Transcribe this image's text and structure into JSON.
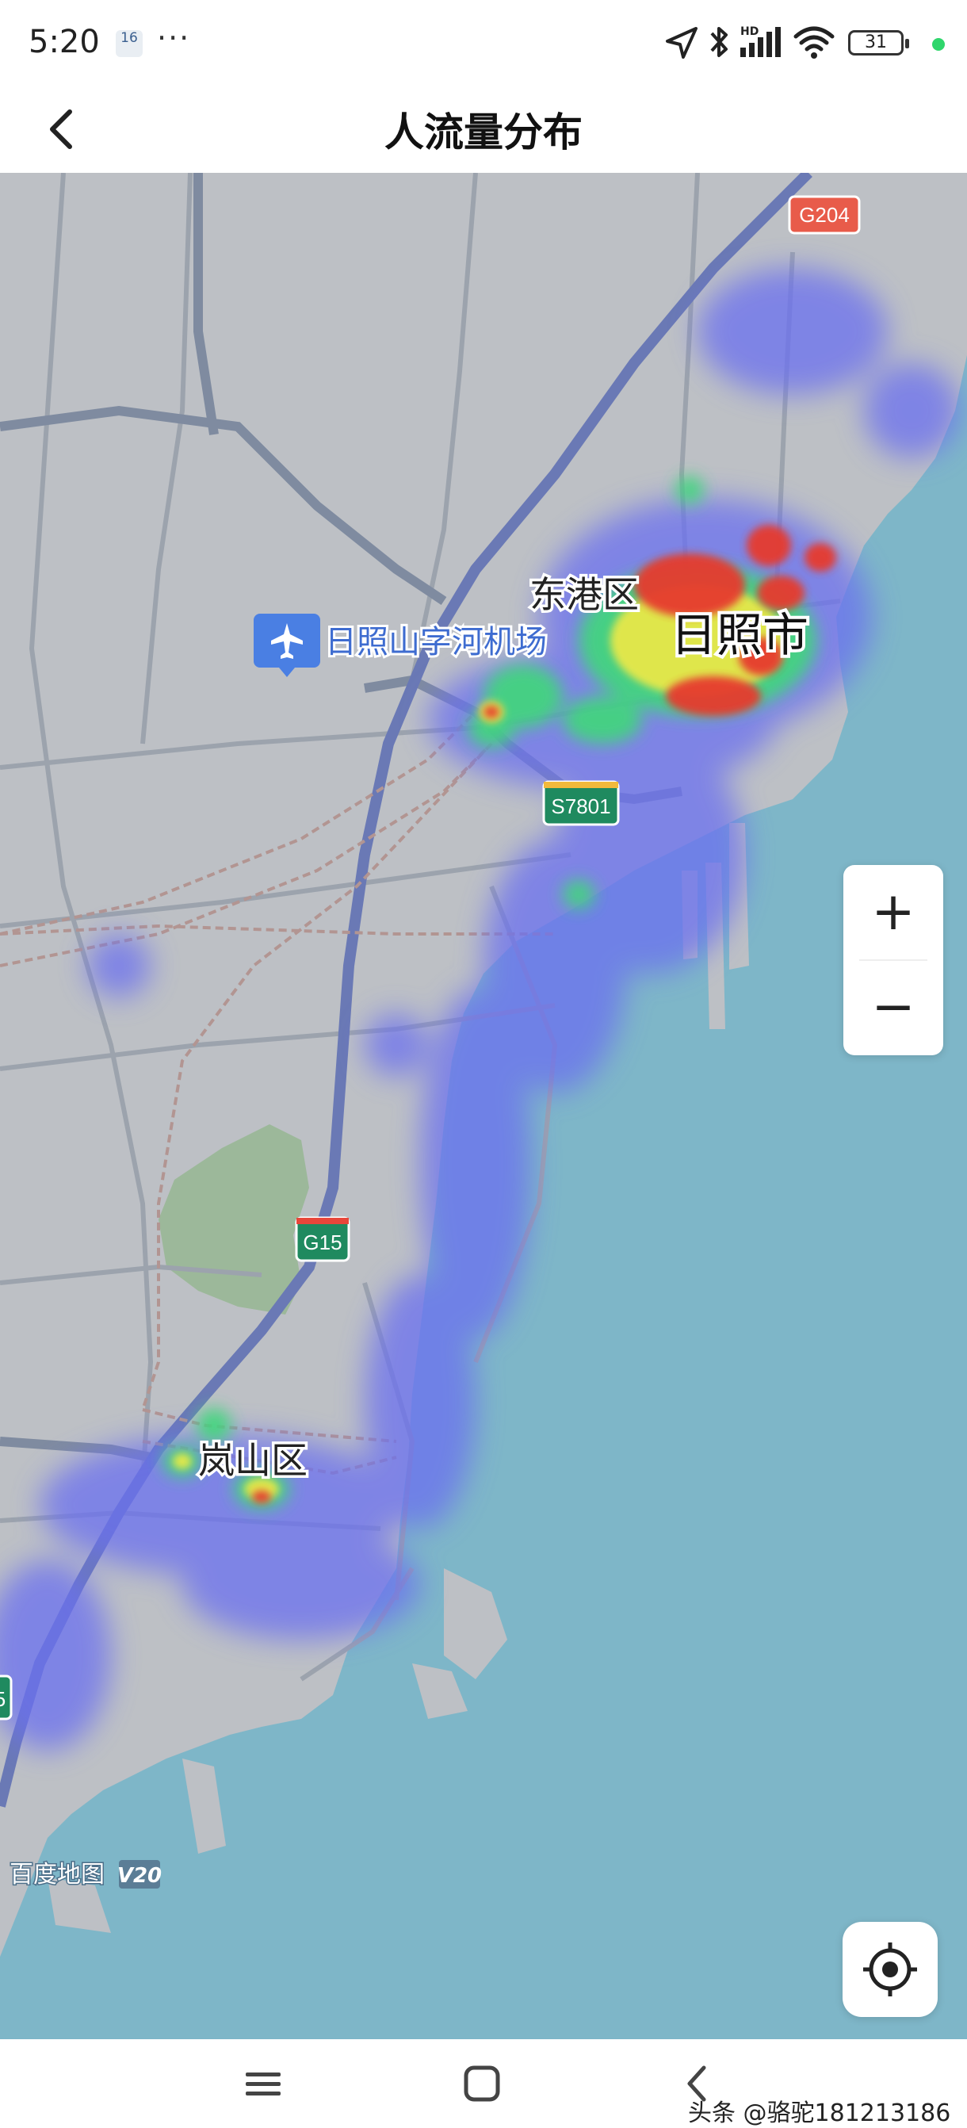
{
  "status_bar": {
    "time": "5:20",
    "calendar_badge": "16",
    "more_dots": "···",
    "battery_level": "31",
    "icons": [
      "location-arrow-icon",
      "bluetooth-icon",
      "hd-signal-icon",
      "wifi-icon",
      "battery-icon",
      "green-dot-icon"
    ]
  },
  "nav": {
    "back_icon": "chevron-left-icon",
    "title": "人流量分布"
  },
  "map": {
    "labels": {
      "airport": "日照山字河机场",
      "donggang": "东港区",
      "rizhao": "日照市",
      "lanshan": "岚山区"
    },
    "road_shields": {
      "g204": "G204",
      "s7801": "S7801",
      "g15": "G15",
      "edge": "5"
    },
    "logo": "百度地图",
    "logo_version": "V20",
    "colors": {
      "sea": "#7eb6c8",
      "land": "#bdc0c5",
      "heat_low": "#6b6ff0",
      "heat_mid": "#3fd87a",
      "heat_high": "#e8e84a",
      "heat_max": "#e63a2f"
    }
  },
  "zoom": {
    "in_label": "+",
    "out_label": "−"
  },
  "system_nav": {
    "icons": [
      "menu-icon",
      "home-square-icon",
      "back-icon"
    ]
  },
  "watermark": "头条 @骆驼181213186"
}
